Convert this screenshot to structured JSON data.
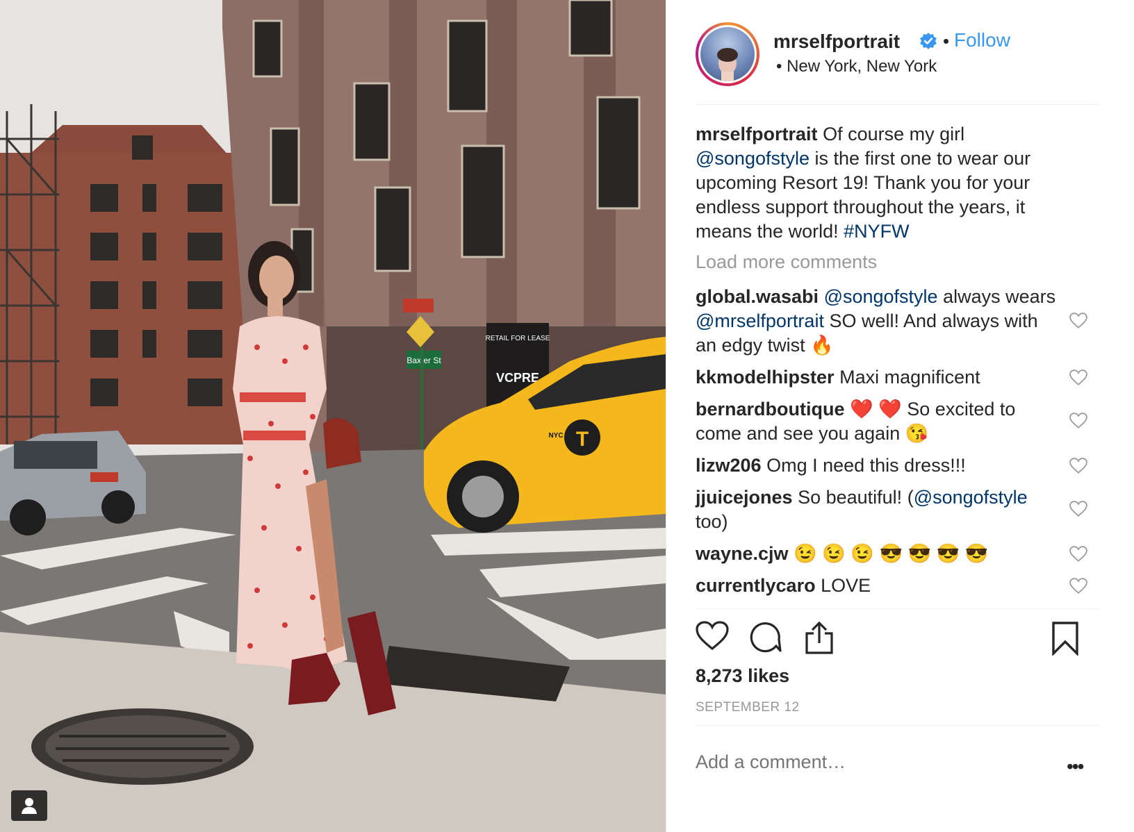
{
  "post": {
    "username": "mrselfportrait",
    "follow_label": "Follow",
    "separator": "•",
    "location": "• New York, New York",
    "caption": {
      "t1": "Of course my girl",
      "mention": "@songofstyle",
      "t2": "is the first one to wear our upcoming Resort 19! Thank you for your endless support throughout the years, it means the world!",
      "hashtag": "#NYFW"
    },
    "load_more": "Load more comments",
    "comments": [
      {
        "user": "global.wasabi",
        "m1": "@songofstyle",
        "t1": "always wears",
        "m2": "@mrselfportrait",
        "t2": "SO well! And always with an edgy twist",
        "emoji": "🔥"
      },
      {
        "user": "kkmodelhipster",
        "text": "Maxi magnificent"
      },
      {
        "user": "bernardboutique",
        "e1": "❤️ ❤️",
        "text": "So excited to come and see you again",
        "e2": "😘"
      },
      {
        "user": "lizw206",
        "text": "Omg I need this dress!!!"
      },
      {
        "user": "jjuicejones",
        "t1": "So beautiful! (",
        "mention": "@songofstyle",
        "t2": "too)"
      },
      {
        "user": "wayne.cjw",
        "emoji": "😉 😉 😉 😎 😎 😎 😎"
      },
      {
        "user": "currentlycaro",
        "text": "LOVE"
      }
    ],
    "likes": "8,273 likes",
    "date": "SEPTEMBER 12",
    "add_comment_placeholder": "Add a comment…",
    "more_label": "•••"
  },
  "photo": {
    "signs": {
      "sign_street": "Baxter St",
      "sign_lease": "RETAIL FOR LEASE",
      "sign_brand": "VCPRE",
      "taxi_logo": "T",
      "taxi_text": "NYC"
    }
  },
  "colors": {
    "accent": "#3897f0",
    "mention": "#003569",
    "muted": "#999999",
    "taxi": "#f4b81c"
  },
  "icons": [
    "heart-icon",
    "comment-icon",
    "share-icon",
    "bookmark-icon",
    "verified-badge-icon",
    "user-tag-icon"
  ]
}
